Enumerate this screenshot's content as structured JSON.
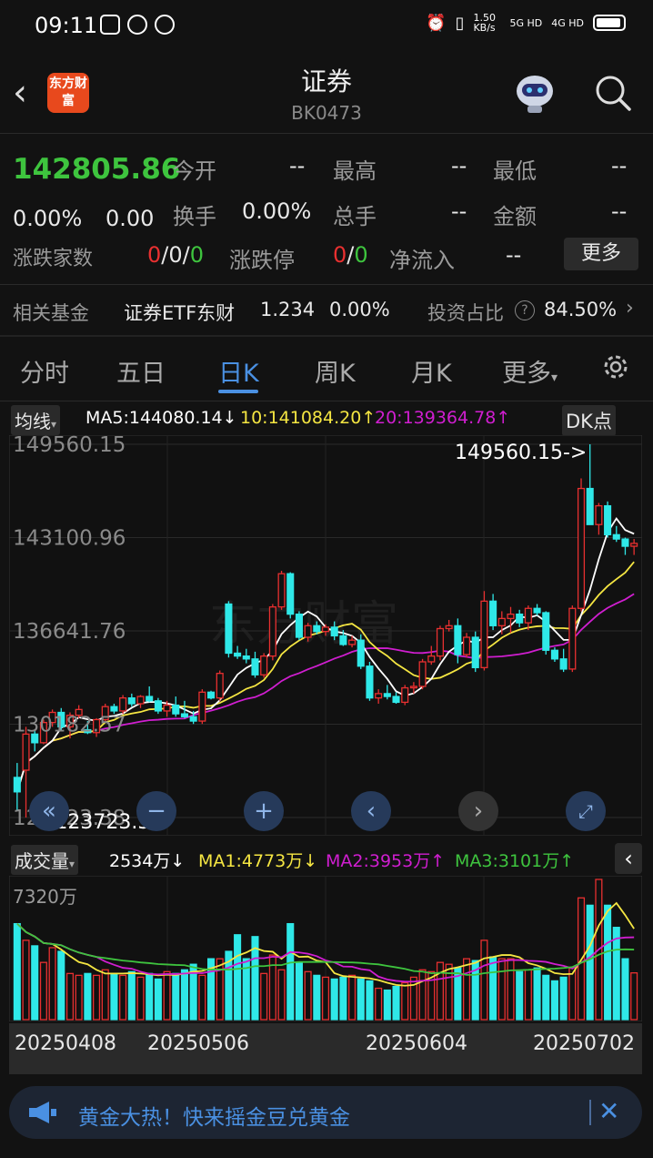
{
  "status_bar": {
    "time": "09:11",
    "net_speed": "1.50 KB/s",
    "sig1": "5G HD",
    "sig2": "4G HD"
  },
  "header": {
    "logo_text": "东方财富",
    "title": "证券",
    "code": "BK0473"
  },
  "quote": {
    "price": "142805.86",
    "change_pct": "0.00%",
    "change_amt": "0.00",
    "open_label": "今开",
    "open_value": "--",
    "high_label": "最高",
    "high_value": "--",
    "low_label": "最低",
    "low_value": "--",
    "turnover_label": "换手",
    "turnover_value": "0.00%",
    "volume_label": "总手",
    "volume_value": "--",
    "amount_label": "金额",
    "amount_value": "--",
    "advdec_label": "涨跌家数",
    "adv": "0",
    "flat": "0",
    "dec": "0",
    "limit_label": "涨跌停",
    "limit_up": "0",
    "limit_down": "0",
    "inflow_label": "净流入",
    "inflow_value": "--",
    "more_button": "更多"
  },
  "fund": {
    "label": "相关基金",
    "name": "证券ETF东财",
    "price": "1.234",
    "pct": "0.00%",
    "ratio_label": "投资占比",
    "ratio_value": "84.50%"
  },
  "tabs": [
    "分时",
    "五日",
    "日K",
    "周K",
    "月K",
    "更多"
  ],
  "active_tab": "日K",
  "ma_bar": {
    "dropdown": "均线",
    "ma5": "MA5:144080.14",
    "ma10": "10:141084.20",
    "ma20": "20:139364.78",
    "dk_button": "DK点"
  },
  "price_axis": [
    "149560.15",
    "143100.96",
    "136641.76",
    "130182.57",
    "123723.38"
  ],
  "max_marker": "149560.15->",
  "min_marker": "<-123723.38",
  "vol_bar": {
    "dropdown": "成交量",
    "current": "2534万",
    "ma1": "MA1:4773万",
    "ma2": "MA2:3953万",
    "ma3": "MA3:3101万"
  },
  "vol_axis": "7320万",
  "dates": [
    "20250408",
    "20250506",
    "20250604",
    "20250702"
  ],
  "ad_text": "黄金大热！快来摇金豆兑黄金",
  "colors": {
    "up": "#e83030",
    "down": "#2fe8e8",
    "ma5": "#ffffff",
    "ma10": "#f5e642",
    "ma20": "#d01ed0",
    "vol_ma3": "#3ec43e",
    "accent": "#4a90e2"
  },
  "chart_data": {
    "type": "candlestick",
    "ylim": [
      123723.38,
      149560.15
    ],
    "candles": [
      [
        126500,
        127500,
        124200,
        125500
      ],
      [
        127000,
        130000,
        123723.38,
        129500
      ],
      [
        129500,
        129800,
        128300,
        128900
      ],
      [
        128900,
        130500,
        128800,
        130300
      ],
      [
        130300,
        131200,
        130000,
        131000
      ],
      [
        131000,
        131300,
        129700,
        130000
      ],
      [
        130000,
        131000,
        129200,
        130800
      ],
      [
        130800,
        131500,
        130600,
        131200
      ],
      [
        129800,
        130400,
        129500,
        129600
      ],
      [
        129600,
        130600,
        129300,
        130500
      ],
      [
        130500,
        131600,
        130400,
        131400
      ],
      [
        131400,
        131600,
        130900,
        131100
      ],
      [
        131100,
        132200,
        130900,
        132000
      ],
      [
        132000,
        132300,
        131400,
        131600
      ],
      [
        131600,
        132200,
        131300,
        132100
      ],
      [
        132100,
        132800,
        131700,
        131800
      ],
      [
        131800,
        132000,
        130900,
        131100
      ],
      [
        131100,
        131800,
        130700,
        131500
      ],
      [
        131500,
        132100,
        130700,
        130900
      ],
      [
        130900,
        131800,
        130600,
        130700
      ],
      [
        130700,
        131100,
        130200,
        130400
      ],
      [
        130400,
        132600,
        130200,
        132400
      ],
      [
        132400,
        132500,
        131900,
        132000
      ],
      [
        132000,
        133900,
        131800,
        133700
      ],
      [
        138500,
        138700,
        134800,
        135100
      ],
      [
        135100,
        135600,
        134700,
        134900
      ],
      [
        134900,
        135400,
        134400,
        134700
      ],
      [
        134700,
        135200,
        133400,
        133600
      ],
      [
        133600,
        135100,
        133400,
        134900
      ],
      [
        134900,
        138500,
        134600,
        138300
      ],
      [
        138300,
        140800,
        138100,
        140600
      ],
      [
        140600,
        140700,
        137500,
        137800
      ],
      [
        137800,
        138000,
        136000,
        136200
      ],
      [
        136200,
        137200,
        135900,
        137000
      ],
      [
        137000,
        137300,
        136400,
        136600
      ],
      [
        136600,
        137100,
        136300,
        136900
      ],
      [
        136900,
        137300,
        136000,
        136300
      ],
      [
        136300,
        136700,
        135600,
        135700
      ],
      [
        135700,
        136300,
        135500,
        136000
      ],
      [
        136000,
        136400,
        134000,
        134200
      ],
      [
        134200,
        134500,
        131800,
        132000
      ],
      [
        132000,
        132600,
        131600,
        132300
      ],
      [
        132300,
        132900,
        131900,
        132100
      ],
      [
        132100,
        132400,
        131600,
        131700
      ],
      [
        131700,
        132900,
        131500,
        132700
      ],
      [
        132700,
        133100,
        132300,
        132800
      ],
      [
        132800,
        134700,
        132600,
        134500
      ],
      [
        134500,
        135600,
        134300,
        134900
      ],
      [
        134900,
        137000,
        134600,
        136800
      ],
      [
        136800,
        137400,
        136600,
        137000
      ],
      [
        137000,
        137500,
        134400,
        135000
      ],
      [
        135000,
        136500,
        134800,
        136200
      ],
      [
        136200,
        136600,
        133800,
        134100
      ],
      [
        134100,
        139400,
        133900,
        138700
      ],
      [
        138700,
        139200,
        136700,
        137000
      ],
      [
        137000,
        138000,
        136400,
        137500
      ],
      [
        137500,
        138300,
        136500,
        137800
      ],
      [
        137800,
        138100,
        136900,
        137200
      ],
      [
        137200,
        138400,
        136700,
        138200
      ],
      [
        138200,
        138500,
        137700,
        137900
      ],
      [
        137900,
        138000,
        135000,
        135300
      ],
      [
        135300,
        135500,
        134500,
        134700
      ],
      [
        134700,
        135400,
        133800,
        134000
      ],
      [
        134000,
        138400,
        133800,
        138200
      ],
      [
        138200,
        147200,
        138000,
        146500
      ],
      [
        146500,
        149560.15,
        145900,
        144000
      ],
      [
        144000,
        145500,
        143300,
        145300
      ],
      [
        145300,
        145600,
        143100,
        143300
      ],
      [
        143300,
        143900,
        142800,
        143000
      ],
      [
        143000,
        143100,
        141900,
        142500
      ],
      [
        142500,
        143000,
        141900,
        142700
      ]
    ],
    "volumes_wan": [
      5200,
      4300,
      4000,
      3100,
      3900,
      3700,
      2500,
      2400,
      2500,
      2400,
      2700,
      2500,
      2400,
      2600,
      2300,
      2500,
      2200,
      2600,
      2500,
      2700,
      3000,
      2400,
      3300,
      3300,
      3700,
      4600,
      3300,
      4500,
      2500,
      3500,
      2700,
      5200,
      3100,
      2600,
      2400,
      2300,
      2200,
      2300,
      2400,
      2200,
      2100,
      1700,
      1600,
      1800,
      2000,
      2300,
      2700,
      2600,
      3100,
      3000,
      2800,
      3300,
      3200,
      4300,
      3400,
      3300,
      3300,
      2600,
      2700,
      2800,
      2400,
      2100,
      2300,
      2800,
      6600,
      6200,
      7600,
      6200,
      5000,
      3300,
      2534
    ]
  }
}
